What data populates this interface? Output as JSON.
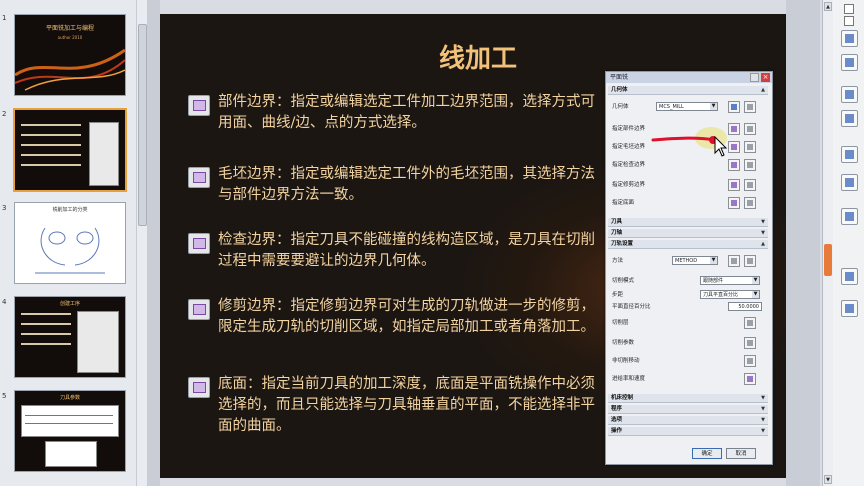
{
  "thumbnails": {
    "numbers": [
      "1",
      "2",
      "3",
      "4",
      "5"
    ],
    "slide1": {
      "title": "平面铣加工与编程",
      "subtitle": "author 2010"
    },
    "slide3": {
      "title": "铣削加工的分类"
    },
    "slide4": {
      "title": "创建工序"
    },
    "slide5": {
      "title": "刀具参数"
    }
  },
  "slide": {
    "title": "线加工",
    "bullets": [
      {
        "icon": "part-boundary-icon",
        "text": "部件边界：指定或编辑选定工件加工边界范围，选择方式可用面、曲线/边、点的方式选择。"
      },
      {
        "icon": "blank-boundary-icon",
        "text": "毛坯边界：指定或编辑选定工件外的毛坯范围，其选择方法与部件边界方法一致。"
      },
      {
        "icon": "check-boundary-icon",
        "text": "检查边界：指定刀具不能碰撞的线构造区域，是刀具在切削过程中需要要避让的边界几何体。"
      },
      {
        "icon": "trim-boundary-icon",
        "text": "修剪边界：指定修剪边界可对生成的刀轨做进一步的修剪，限定生成刀轨的切削区域，如指定局部加工或者角落加工。"
      },
      {
        "icon": "floor-icon",
        "text": "底面：指定当前刀具的加工深度，底面是平面铣操作中必须选择的，而且只能选择与刀具轴垂直的平面，不能选择非平面的曲面。"
      }
    ]
  },
  "dialog": {
    "title": "平面铣",
    "sections": {
      "geometry": "几何体",
      "tool": "刀具",
      "tool_axis": "刀轴",
      "path_settings": "刀轨设置",
      "machine_control": "机床控制",
      "program": "程序",
      "options": "选项",
      "actions": "操作"
    },
    "geometry_rows": {
      "geometry_label": "几何体",
      "geometry_value": "MCS_MILL",
      "part_boundary": "指定部件边界",
      "blank_boundary": "指定毛坯边界",
      "check_boundary": "指定检查边界",
      "trim_boundary": "指定修剪边界",
      "floor": "指定底面"
    },
    "path_rows": {
      "method_label": "方法",
      "method_value": "METHOD",
      "cut_pattern_label": "切削模式",
      "cut_pattern_value": "跟随部件",
      "stepover_label": "步距",
      "stepover_value": "刀具平直百分比",
      "percent_label": "平面直径百分比",
      "percent_value": "50.0000",
      "cut_levels": "切削层",
      "cut_params": "切削参数",
      "non_cut_moves": "非切削移动",
      "feeds_speeds": "进给率和速度"
    },
    "ok": "确定",
    "cancel": "取消"
  },
  "colors": {
    "slide_bg": "#1b1612",
    "slide_text": "#f3d3a0",
    "title_text": "#f2c27a",
    "annotation": "#e0102a",
    "selection_border": "#e8a13a"
  }
}
